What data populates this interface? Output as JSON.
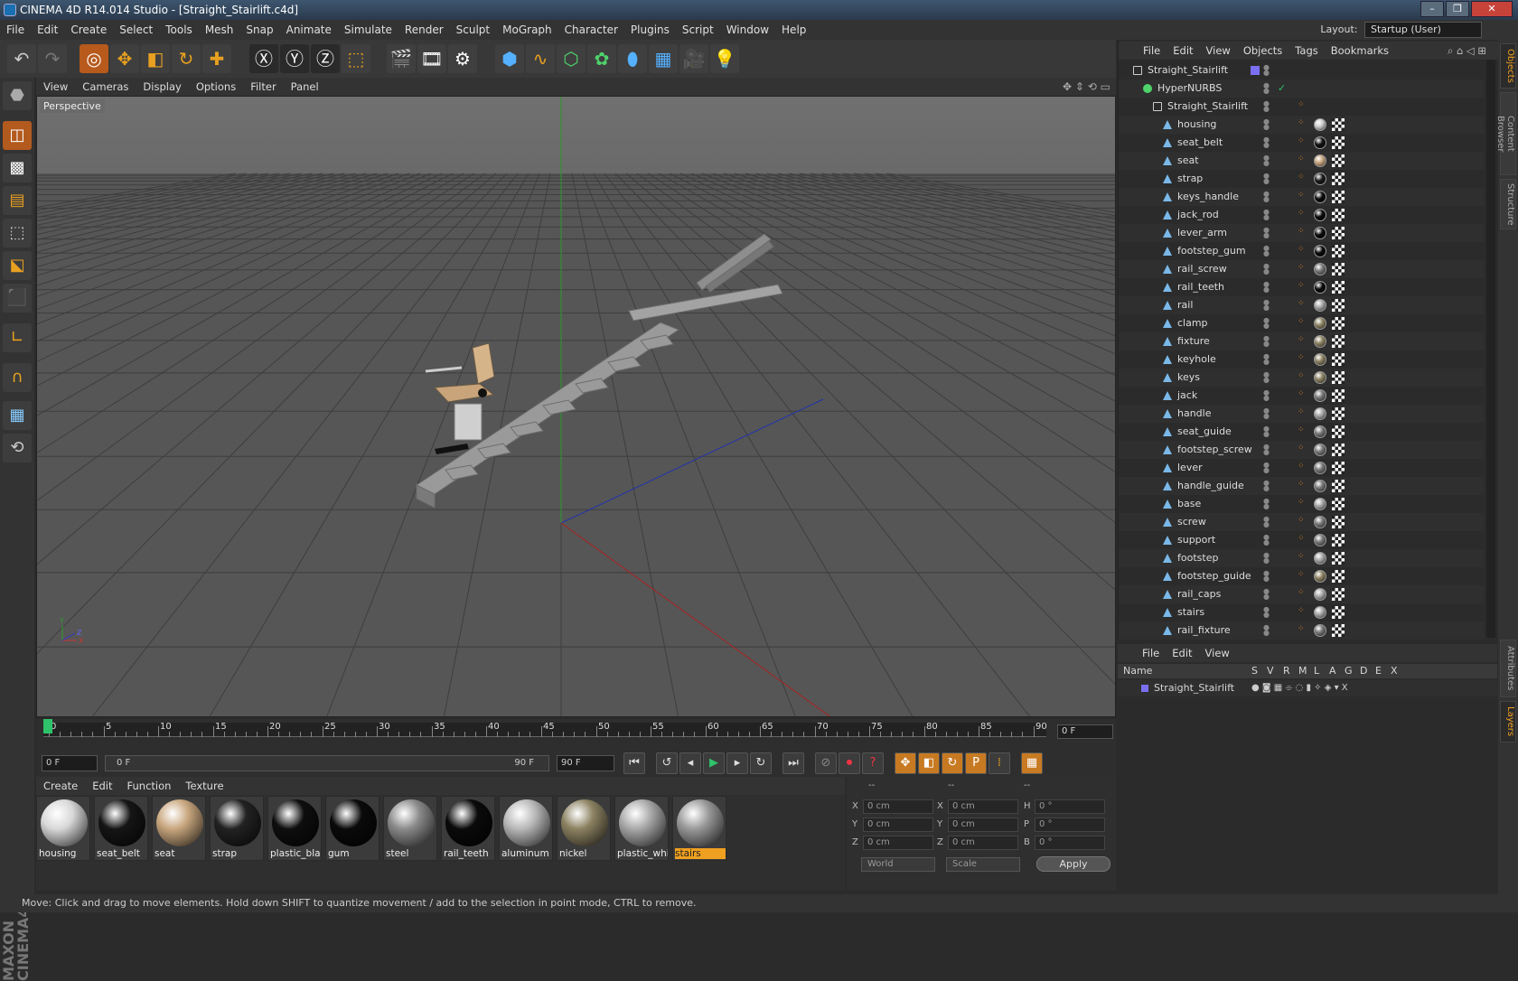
{
  "titlebar": {
    "title": "CINEMA 4D R14.014 Studio - [Straight_Stairlift.c4d]",
    "min": "–",
    "max": "❐",
    "close": "✕"
  },
  "menu": [
    "File",
    "Edit",
    "Create",
    "Select",
    "Tools",
    "Mesh",
    "Snap",
    "Animate",
    "Simulate",
    "Render",
    "Sculpt",
    "MoGraph",
    "Character",
    "Plugins",
    "Script",
    "Window",
    "Help"
  ],
  "layout": {
    "label": "Layout:",
    "value": "Startup (User)"
  },
  "viewport_menu": [
    "View",
    "Cameras",
    "Display",
    "Options",
    "Filter",
    "Panel"
  ],
  "viewport_name": "Perspective",
  "timeline": {
    "ticks": [
      "0",
      "5",
      "10",
      "15",
      "20",
      "25",
      "30",
      "35",
      "40",
      "45",
      "50",
      "55",
      "60",
      "65",
      "70",
      "75",
      "80",
      "85",
      "90"
    ],
    "frame_display": "0 F",
    "start": "0 F",
    "range_start": "0 F",
    "range_end": "90 F",
    "end": "90 F"
  },
  "material_menu": [
    "Create",
    "Edit",
    "Function",
    "Texture"
  ],
  "materials": [
    {
      "name": "housing",
      "color": "#d8d8d8"
    },
    {
      "name": "seat_belt",
      "color": "#151515"
    },
    {
      "name": "seat",
      "color": "#c8a67e"
    },
    {
      "name": "strap",
      "color": "#222222"
    },
    {
      "name": "plastic_blac",
      "color": "#0e0e0e"
    },
    {
      "name": "gum",
      "color": "#0a0a0a"
    },
    {
      "name": "steel",
      "color": "#8a8a8a"
    },
    {
      "name": "rail_teeth",
      "color": "#0a0a0a"
    },
    {
      "name": "aluminum",
      "color": "#b8b8b8"
    },
    {
      "name": "nickel",
      "color": "#8c8262"
    },
    {
      "name": "plastic_whi",
      "color": "#a8a8a8"
    },
    {
      "name": "stairs",
      "color": "#999999"
    }
  ],
  "coords": {
    "header": [
      "--",
      "--",
      "--"
    ],
    "rows": [
      {
        "a": "X",
        "av": "0 cm",
        "b": "X",
        "bv": "0 cm",
        "c": "H",
        "cv": "0 °"
      },
      {
        "a": "Y",
        "av": "0 cm",
        "b": "Y",
        "bv": "0 cm",
        "c": "P",
        "cv": "0 °"
      },
      {
        "a": "Z",
        "av": "0 cm",
        "b": "Z",
        "bv": "0 cm",
        "c": "B",
        "cv": "0 °"
      }
    ],
    "space": "World",
    "mode": "Scale",
    "apply": "Apply"
  },
  "objects_menu": [
    "File",
    "Edit",
    "View",
    "Objects",
    "Tags",
    "Bookmarks"
  ],
  "objects": [
    {
      "name": "Straight_Stairlift",
      "depth": 0,
      "type": "null"
    },
    {
      "name": "HyperNURBS",
      "depth": 1,
      "type": "nurbs"
    },
    {
      "name": "Straight_Stairlift",
      "depth": 2,
      "type": "null"
    },
    {
      "name": "housing",
      "depth": 3,
      "type": "poly",
      "mat": "#cfcfcf"
    },
    {
      "name": "seat_belt",
      "depth": 3,
      "type": "poly",
      "mat": "#111111"
    },
    {
      "name": "seat",
      "depth": 3,
      "type": "poly",
      "mat": "#c8a67e"
    },
    {
      "name": "strap",
      "depth": 3,
      "type": "poly",
      "mat": "#1a1a1a"
    },
    {
      "name": "keys_handle",
      "depth": 3,
      "type": "poly",
      "mat": "#0a0a0a"
    },
    {
      "name": "jack_rod",
      "depth": 3,
      "type": "poly",
      "mat": "#0a0a0a"
    },
    {
      "name": "lever_arm",
      "depth": 3,
      "type": "poly",
      "mat": "#0a0a0a"
    },
    {
      "name": "footstep_gum",
      "depth": 3,
      "type": "poly",
      "mat": "#0a0a0a"
    },
    {
      "name": "rail_screw",
      "depth": 3,
      "type": "poly",
      "mat": "#777777"
    },
    {
      "name": "rail_teeth",
      "depth": 3,
      "type": "poly",
      "mat": "#0a0a0a"
    },
    {
      "name": "rail",
      "depth": 3,
      "type": "poly",
      "mat": "#aaaaaa"
    },
    {
      "name": "clamp",
      "depth": 3,
      "type": "poly",
      "mat": "#8c8262"
    },
    {
      "name": "fixture",
      "depth": 3,
      "type": "poly",
      "mat": "#8c8262"
    },
    {
      "name": "keyhole",
      "depth": 3,
      "type": "poly",
      "mat": "#8c8262"
    },
    {
      "name": "keys",
      "depth": 3,
      "type": "poly",
      "mat": "#8c8262"
    },
    {
      "name": "jack",
      "depth": 3,
      "type": "poly",
      "mat": "#777777"
    },
    {
      "name": "handle",
      "depth": 3,
      "type": "poly",
      "mat": "#aaaaaa"
    },
    {
      "name": "seat_guide",
      "depth": 3,
      "type": "poly",
      "mat": "#777777"
    },
    {
      "name": "footstep_screw",
      "depth": 3,
      "type": "poly",
      "mat": "#777777"
    },
    {
      "name": "lever",
      "depth": 3,
      "type": "poly",
      "mat": "#777777"
    },
    {
      "name": "handle_guide",
      "depth": 3,
      "type": "poly",
      "mat": "#777777"
    },
    {
      "name": "base",
      "depth": 3,
      "type": "poly",
      "mat": "#aaaaaa"
    },
    {
      "name": "screw",
      "depth": 3,
      "type": "poly",
      "mat": "#777777"
    },
    {
      "name": "support",
      "depth": 3,
      "type": "poly",
      "mat": "#777777"
    },
    {
      "name": "footstep",
      "depth": 3,
      "type": "poly",
      "mat": "#aaaaaa"
    },
    {
      "name": "footstep_guide",
      "depth": 3,
      "type": "poly",
      "mat": "#8c8262"
    },
    {
      "name": "rail_caps",
      "depth": 3,
      "type": "poly",
      "mat": "#aaaaaa"
    },
    {
      "name": "stairs",
      "depth": 3,
      "type": "poly",
      "mat": "#aaaaaa"
    },
    {
      "name": "rail_fixture",
      "depth": 3,
      "type": "poly",
      "mat": "#777777"
    }
  ],
  "layers_menu": [
    "File",
    "Edit",
    "View"
  ],
  "layers_header": [
    "Name",
    "S",
    "V",
    "R",
    "M",
    "L",
    "A",
    "G",
    "D",
    "E",
    "X"
  ],
  "layers": [
    {
      "name": "Straight_Stairlift",
      "color": "#7a6ff0"
    }
  ],
  "right_tabs": [
    "Objects",
    "Content Browser",
    "Structure",
    "Attributes",
    "Layers"
  ],
  "status": "Move: Click and drag to move elements. Hold down SHIFT to quantize movement / add to the selection in point mode, CTRL to remove.",
  "colors": {
    "accent": "#e8a020",
    "selection": "#b75a1c",
    "play": "#2ec26a"
  }
}
